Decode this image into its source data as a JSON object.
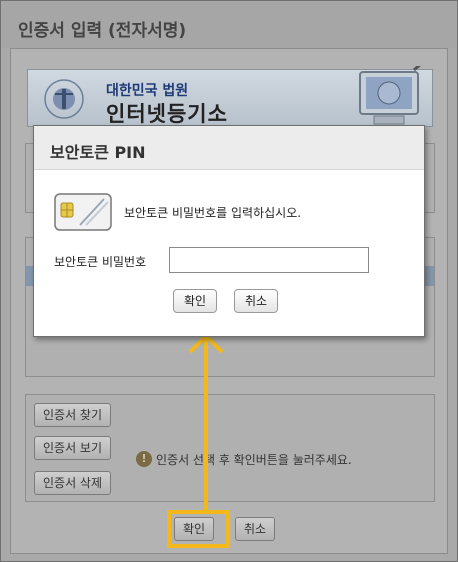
{
  "outer_dialog": {
    "title": "인증서 입력 (전자서명)",
    "banner": {
      "line1": "대한민국 법원",
      "line2": "인터넷등기소"
    },
    "buttons": {
      "find": "인증서 찾기",
      "view": "인증서 보기",
      "delete": "인증서 삭제"
    },
    "notice": "인증서 선택 후 확인버튼을 눌러주세요.",
    "ok_label": "확인",
    "cancel_label": "취소"
  },
  "pin_dialog": {
    "title": "보안토큰 PIN",
    "message": "보안토큰 비밀번호를 입력하십시오.",
    "field_label": "보안토큰 비밀번호",
    "field_value": "",
    "ok_label": "확인",
    "cancel_label": "취소"
  },
  "annotation": {
    "highlight_color": "#f3b91b"
  },
  "icons": {
    "card": "smart-card-icon",
    "notice": "info-icon",
    "emblem": "court-emblem-icon"
  }
}
